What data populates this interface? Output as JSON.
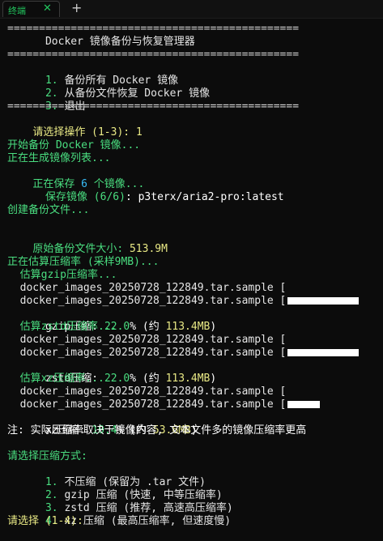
{
  "tab": {
    "title": "终端",
    "close": "✕",
    "new_tab": "+"
  },
  "separator": "==============================================",
  "menu": {
    "title": "      Docker 镜像备份与恢复管理器",
    "items": [
      {
        "num": "1.",
        "text": " 备份所有 Docker 镜像"
      },
      {
        "num": "2.",
        "text": " 从备份文件恢复 Docker 镜像"
      },
      {
        "num": "3.",
        "text": " 退出"
      }
    ],
    "prompt": "请选择操作 (1-3): ",
    "input": "1"
  },
  "backup": {
    "start": "开始备份 Docker 镜像...",
    "gen_list": "正在生成镜像列表...",
    "saving_pre": "正在保存 ",
    "count": "6",
    "saving_post": " 个镜像...",
    "save_label": "  保存镜像 ",
    "save_progress": "(6/6)",
    "save_image": ": p3terx/aria2-pro:latest",
    "create_file": "创建备份文件...",
    "orig_size_label": "原始备份文件大小: ",
    "orig_size": "513.9M"
  },
  "estimate": {
    "header": "正在估算压缩率 (采样9MB)...",
    "sample_file": "docker_images_20250728_122849.tar.sample [",
    "gzip": {
      "label": "估算gzip压缩率...",
      "result_name": "gzip压缩: ",
      "ratio": "22.0",
      "pct_suffix": "% (约 ",
      "size": "113.4MB",
      "close": ")",
      "progress": 1.0
    },
    "zstd": {
      "label": "估算zstd压缩率...",
      "result_name": "zstd压缩: ",
      "ratio": "22.0",
      "pct_suffix": "% (约 ",
      "size": "113.4MB",
      "close": ")",
      "progress": 1.0
    },
    "xz": {
      "label": "估算xz压缩率...",
      "result_name": "xz压缩: ",
      "ratio": "10.4",
      "pct_suffix": "% (约 ",
      "size": "53.6MB",
      "close": ")",
      "progress": 0.45
    },
    "note": "注: 实际压缩率取决于镜像内容, 文本文件多的镜像压缩率更高"
  },
  "compression": {
    "header": "请选择压缩方式:",
    "options": [
      {
        "num": "1.",
        "text": " 不压缩 (保留为 .tar 文件)"
      },
      {
        "num": "2.",
        "text": " gzip 压缩 (快速, 中等压缩率)"
      },
      {
        "num": "3.",
        "text": " zstd 压缩 (推荐, 高速高压缩率)"
      },
      {
        "num": "4.",
        "text": " xz 压缩 (最高压缩率, 但速度慢)"
      }
    ],
    "prompt": "请选择 (1-4): "
  },
  "colors": {
    "green": "#4ade80",
    "yellow": "#e9e985",
    "cyan": "#38bdf8",
    "tab_green": "#22c55e"
  }
}
